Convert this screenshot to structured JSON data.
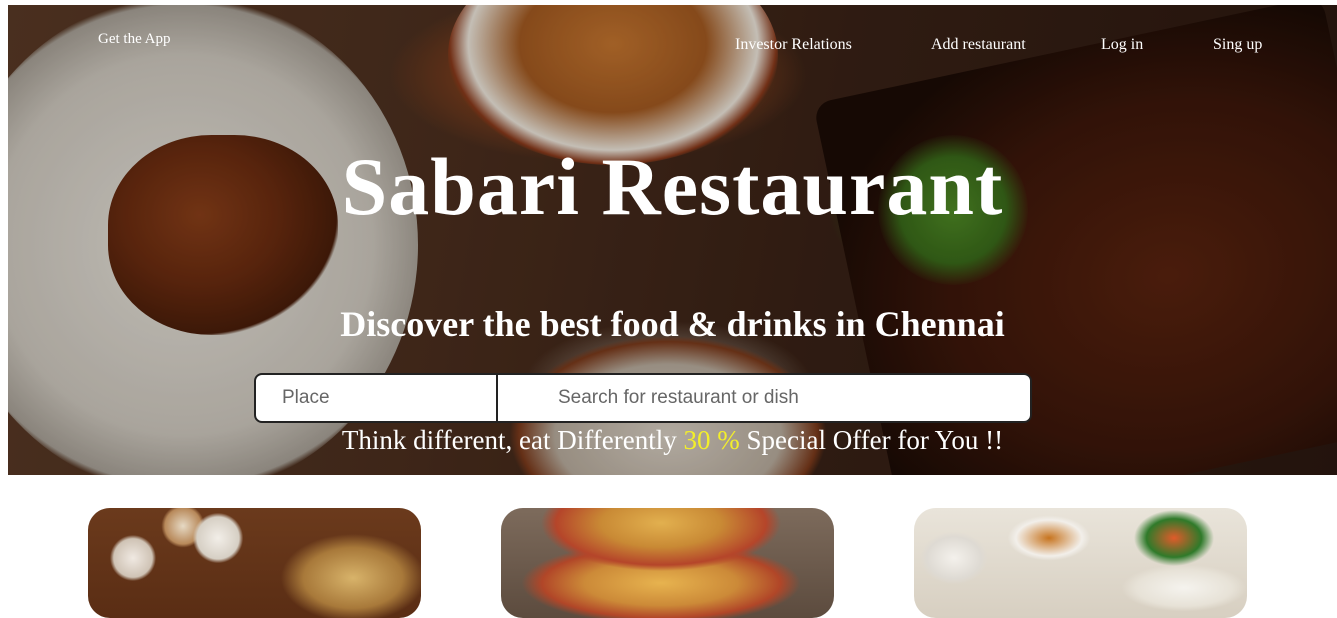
{
  "nav": {
    "get_app": "Get the App",
    "links": [
      {
        "label": "Investor Relations"
      },
      {
        "label": "Add restaurant"
      },
      {
        "label": "Log in"
      },
      {
        "label": "Sing up"
      }
    ]
  },
  "hero": {
    "title": "Sabari Restaurant",
    "subtitle": "Discover the best food & drinks in Chennai",
    "search": {
      "place_placeholder": "Place",
      "dish_placeholder": "Search for restaurant or dish"
    },
    "offer": {
      "before": "Think different, eat Differently ",
      "highlight": "30 %",
      "after": " Special Offer for You !!",
      "highlight_color": "#f3ef2a"
    }
  },
  "cards": [
    {
      "image": "biryani-thali-photo"
    },
    {
      "image": "pizza-photo"
    },
    {
      "image": "idli-sambar-photo"
    }
  ]
}
